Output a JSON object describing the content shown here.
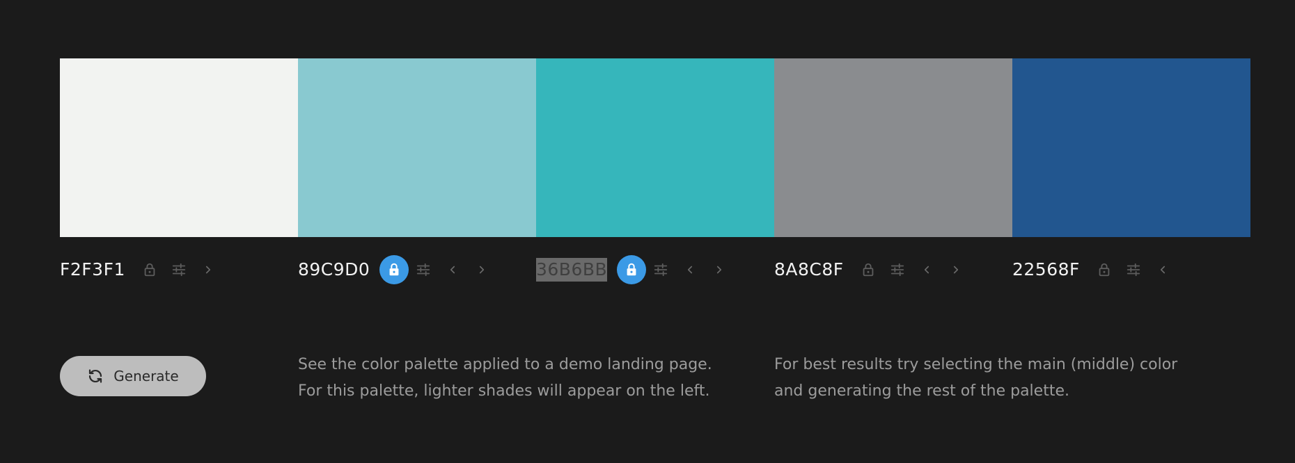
{
  "palette": {
    "colors": [
      {
        "hex": "F2F3F1",
        "color": "#F2F3F1",
        "locked": false,
        "left_arrow": false,
        "right_arrow": true,
        "selected": false
      },
      {
        "hex": "89C9D0",
        "color": "#89C9D0",
        "locked": true,
        "left_arrow": true,
        "right_arrow": true,
        "selected": false
      },
      {
        "hex": "36B6BB",
        "color": "#36B6BB",
        "locked": true,
        "left_arrow": true,
        "right_arrow": true,
        "selected": true
      },
      {
        "hex": "8A8C8F",
        "color": "#8A8C8F",
        "locked": false,
        "left_arrow": true,
        "right_arrow": true,
        "selected": false
      },
      {
        "hex": "22568F",
        "color": "#22568F",
        "locked": false,
        "left_arrow": true,
        "right_arrow": false,
        "selected": false
      }
    ]
  },
  "icons": {
    "lock": "lock-icon",
    "adjust": "sliders-icon",
    "left": "chevron-left-icon",
    "right": "chevron-right-icon",
    "generate": "refresh-icon"
  },
  "accent": "#3B9AE6",
  "generate": {
    "label": "Generate"
  },
  "info": {
    "demo_line1": "See the color palette applied to a demo landing page.",
    "demo_line2": "For this palette, lighter shades will appear on the left.",
    "tip_line1": "For best results try selecting the main (middle) color",
    "tip_line2": "and generating the rest of the palette."
  }
}
